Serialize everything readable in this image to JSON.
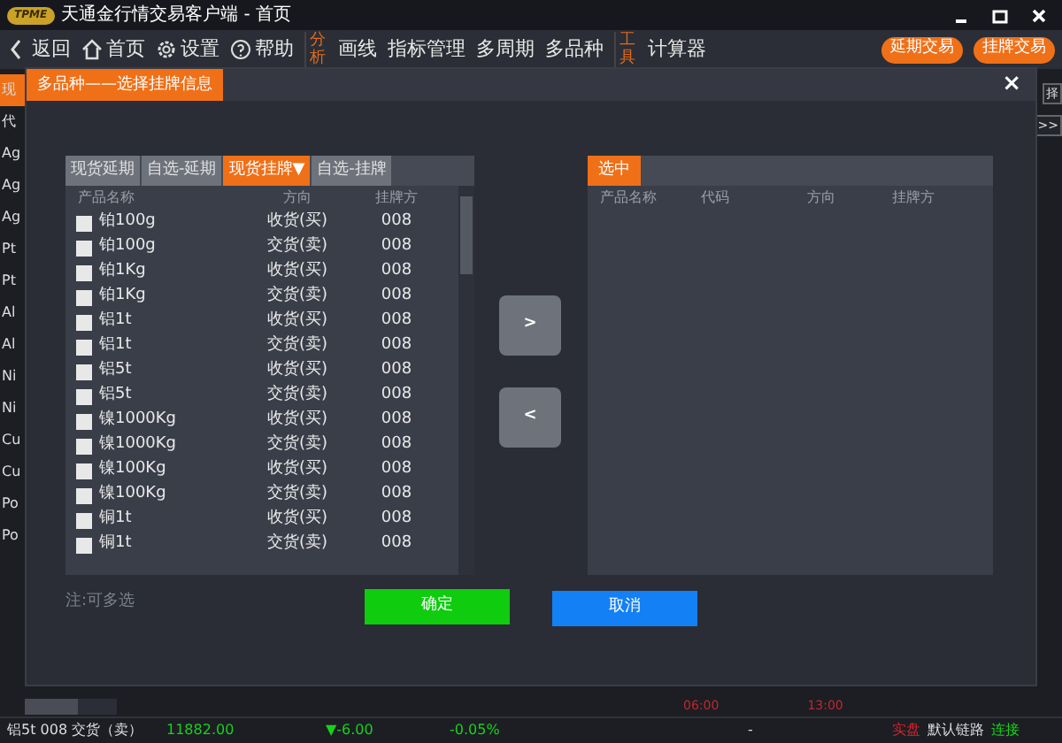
{
  "window": {
    "title": "天通金行情交易客户端 - 首页",
    "logo": "TPME"
  },
  "toolbar": {
    "nav": [
      {
        "label": "返回",
        "kind": "back"
      },
      {
        "label": "首页",
        "kind": "home"
      },
      {
        "label": "设置",
        "kind": "gear"
      },
      {
        "label": "帮助",
        "kind": "help"
      }
    ],
    "groups": [
      {
        "label": "分析",
        "items": [
          "画线",
          "指标管理",
          "多周期",
          "多品种"
        ]
      },
      {
        "label": "工具",
        "items": [
          "计算器"
        ]
      }
    ],
    "actions": [
      "延期交易",
      "挂牌交易"
    ]
  },
  "background": {
    "left_labels": [
      "现",
      "代",
      "Ag",
      "Ag",
      "Ag",
      "Pt",
      "Pt",
      "Al",
      "Al",
      "Ni",
      "Ni",
      "Cu",
      "Cu",
      "Po",
      "Po"
    ],
    "right_labels": [
      "择",
      ">>"
    ],
    "axis_times": [
      "06:00",
      "13:00"
    ]
  },
  "dialog": {
    "title": "多品种——选择挂牌信息",
    "close": "×",
    "tabs": [
      {
        "label": "现货延期",
        "selected": false
      },
      {
        "label": "自选-延期",
        "selected": false
      },
      {
        "label": "现货挂牌▼",
        "selected": true
      },
      {
        "label": "自选-挂牌",
        "selected": false
      }
    ],
    "left_columns": [
      "产品名称",
      "方向",
      "挂牌方"
    ],
    "rows": [
      {
        "name": "铂100g",
        "direction": "收货(买)",
        "party": "008",
        "checked": false
      },
      {
        "name": "铂100g",
        "direction": "交货(卖)",
        "party": "008",
        "checked": false
      },
      {
        "name": "铂1Kg",
        "direction": "收货(买)",
        "party": "008",
        "checked": false
      },
      {
        "name": "铂1Kg",
        "direction": "交货(卖)",
        "party": "008",
        "checked": false
      },
      {
        "name": "铝1t",
        "direction": "收货(买)",
        "party": "008",
        "checked": false
      },
      {
        "name": "铝1t",
        "direction": "交货(卖)",
        "party": "008",
        "checked": false
      },
      {
        "name": "铝5t",
        "direction": "收货(买)",
        "party": "008",
        "checked": false
      },
      {
        "name": "铝5t",
        "direction": "交货(卖)",
        "party": "008",
        "checked": false
      },
      {
        "name": "镍1000Kg",
        "direction": "收货(买)",
        "party": "008",
        "checked": false
      },
      {
        "name": "镍1000Kg",
        "direction": "交货(卖)",
        "party": "008",
        "checked": false
      },
      {
        "name": "镍100Kg",
        "direction": "收货(买)",
        "party": "008",
        "checked": false
      },
      {
        "name": "镍100Kg",
        "direction": "交货(卖)",
        "party": "008",
        "checked": false
      },
      {
        "name": "铜1t",
        "direction": "收货(买)",
        "party": "008",
        "checked": false
      },
      {
        "name": "铜1t",
        "direction": "交货(卖)",
        "party": "008",
        "checked": false
      }
    ],
    "move_buttons": [
      ">",
      "<"
    ],
    "selected_title": "选中",
    "right_columns": [
      "产品名称",
      "代码",
      "方向",
      "挂牌方"
    ],
    "note": "注:可多选",
    "confirm": "确定",
    "cancel": "取消"
  },
  "status_bar": [
    {
      "text": "铝5t 008 交货（卖）",
      "kind": "plain"
    },
    {
      "text": "11882.00",
      "kind": "up"
    },
    {
      "text": "▼-6.00",
      "kind": "up"
    },
    {
      "text": "-0.05%",
      "kind": "up"
    },
    {
      "text": "-",
      "kind": "plain"
    },
    {
      "text": "实盘",
      "kind": "alert"
    },
    {
      "text": "默认链路",
      "kind": "plain"
    },
    {
      "text": "连接",
      "kind": "up"
    }
  ]
}
